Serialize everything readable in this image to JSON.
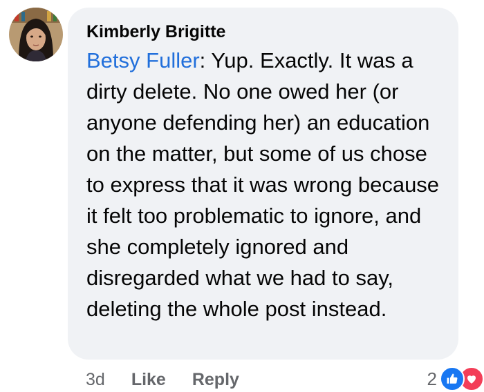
{
  "comment": {
    "author": "Kimberly Brigitte",
    "mention": "Betsy Fuller",
    "text": ": Yup. Exactly. It was a dirty delete. No one owed her (or anyone defending her) an education on the matter, but some of us chose to express that it was wrong because it felt too problematic to ignore, and she completely ignored and disregarded what we had to say, deleting the whole post instead."
  },
  "actions": {
    "time": "3d",
    "like": "Like",
    "reply": "Reply"
  },
  "reactions": {
    "count": "2",
    "icons": [
      "like-icon",
      "love-icon"
    ],
    "colors": {
      "like": "#1877f2",
      "love": "#f33e58",
      "mention": "#216fdb"
    }
  }
}
